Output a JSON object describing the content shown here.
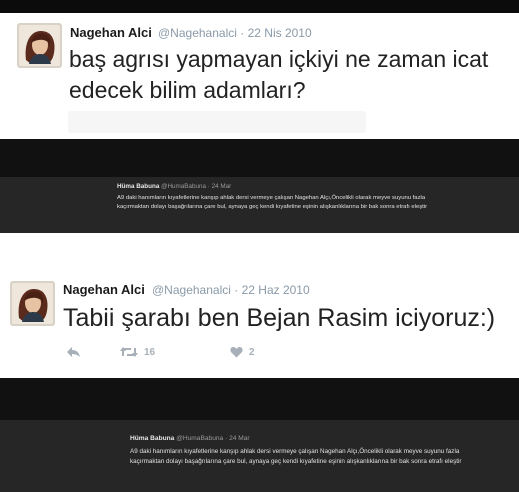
{
  "shot1": {
    "author_name": "Nagehan Alci",
    "handle": "@Nagehanalci",
    "date": "22 Nis 2010",
    "tweet_text": "baş agrısı yapmayan içkiyi ne zaman icat edecek bilim adamları?",
    "reply": {
      "name": "Hüma Babuna",
      "handle": "@HumaBabuna",
      "time": "24 Mar",
      "text": "A9 daki hanımların kıyafetlerine kanşıp ahlak dersi vermeye çalışan Nagehan Alçı,Öncelikli olarak meyve suyunu fazla kaçırmaktan dolayı başağrılarına çare bul, aynaya geç kendi kıyafetine eşinin alışkanlıklarına bir bak sonra etrafı eleştir"
    }
  },
  "shot2": {
    "author_name": "Nagehan Alci",
    "handle": "@Nagehanalci",
    "date": "22 Haz 2010",
    "tweet_text": "Tabii şarabı ben Bejan Rasim iciyoruz:)",
    "retweet_count": "16",
    "like_count": "2",
    "reply": {
      "name": "Hüma Babuna",
      "handle": "@HumaBabuna",
      "time": "24 Mar",
      "text": "A9 daki hanımların kıyafetlerine kanşıp ahlak dersi vermeye çalışan Nagehan Alçı,Öncelikli olarak meyve suyunu fazla kaçırmaktan dolayı başağrılarına çare bul, aynaya geç kendi kıyafetine eşinin alışkanlıklarına bir bak sonra etrafı eleştir"
    }
  },
  "icons": {
    "avatar": "profile-photo",
    "reply": "reply-arrow",
    "retweet": "retweet-arrows",
    "like": "heart"
  },
  "colors": {
    "meta_text": "#8a9aa8",
    "action_icon": "#a7b0b8",
    "dark_band": "#111111",
    "reply_background": "#262626"
  }
}
